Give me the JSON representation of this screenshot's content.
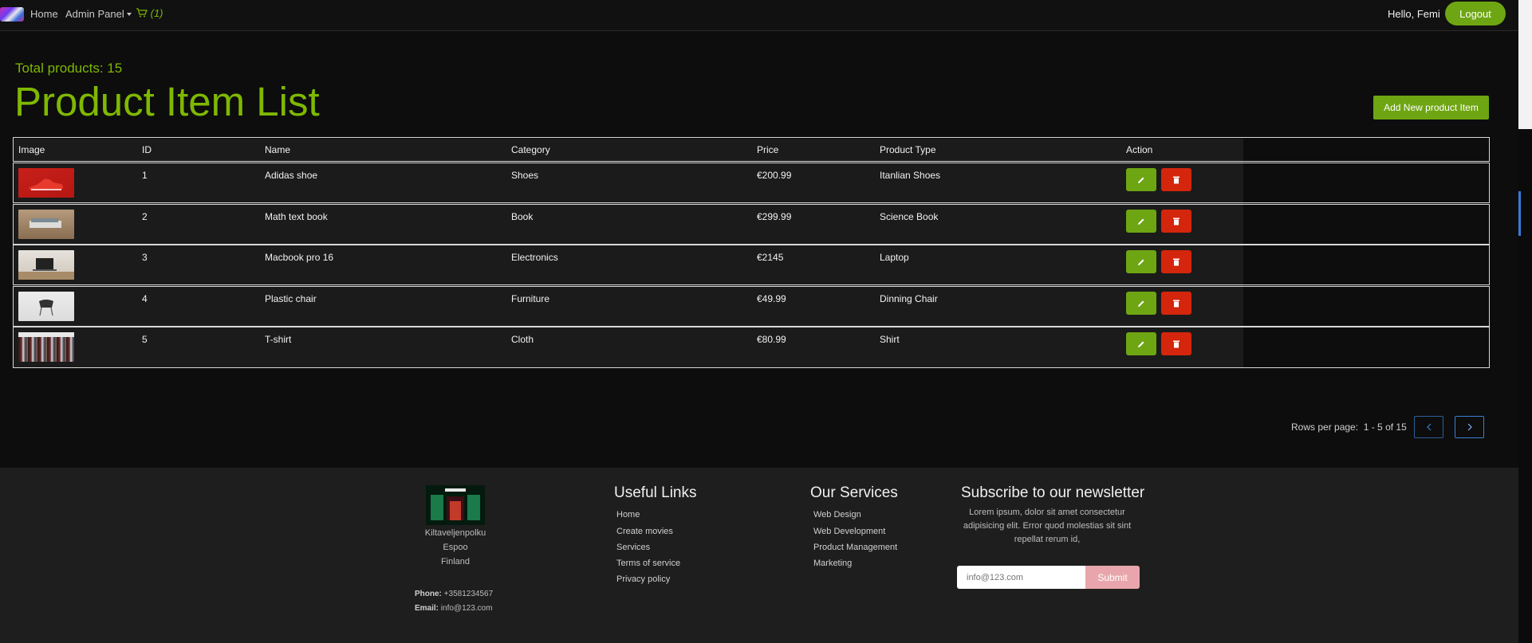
{
  "nav": {
    "home": "Home",
    "admin_panel": "Admin Panel",
    "cart_count": "(1)",
    "greeting": "Hello, Femi",
    "logout": "Logout"
  },
  "header": {
    "total": "Total products: 15",
    "title": "Product Item List",
    "add_button": "Add New product Item"
  },
  "table": {
    "columns": [
      "Image",
      "ID",
      "Name",
      "Category",
      "Price",
      "Product Type",
      "Action"
    ],
    "rows": [
      {
        "id": "1",
        "name": "Adidas shoe",
        "category": "Shoes",
        "price": "€200.99",
        "type": "Itanlian Shoes"
      },
      {
        "id": "2",
        "name": "Math text book",
        "category": "Book",
        "price": "€299.99",
        "type": "Science Book"
      },
      {
        "id": "3",
        "name": "Macbook pro 16",
        "category": "Electronics",
        "price": "€2145",
        "type": "Laptop"
      },
      {
        "id": "4",
        "name": "Plastic chair",
        "category": "Furniture",
        "price": "€49.99",
        "type": "Dinning Chair"
      },
      {
        "id": "5",
        "name": "T-shirt",
        "category": "Cloth",
        "price": "€80.99",
        "type": "Shirt"
      }
    ]
  },
  "pagination": {
    "label": "Rows per page:",
    "range": "1 - 5 of 15"
  },
  "footer": {
    "address": [
      "Kiltaveljenpolku",
      "Espoo",
      "Finland"
    ],
    "phone_label": "Phone:",
    "phone": "+3581234567",
    "email_label": "Email:",
    "email": "info@123.com",
    "useful_links_title": "Useful Links",
    "useful_links": [
      "Home",
      "Create movies",
      "Services",
      "Terms of service",
      "Privacy policy"
    ],
    "services_title": "Our Services",
    "services": [
      "Web Design",
      "Web Development",
      "Product Management",
      "Marketing"
    ],
    "newsletter_title": "Subscribe to our newsletter",
    "newsletter_text": "Lorem ipsum, dolor sit amet consectetur adipisicing elit. Error quod molestias sit sint repellat rerum id,",
    "newsletter_placeholder": "info@123.com",
    "submit": "Submit"
  },
  "colors": {
    "accent": "#7fb800",
    "edit": "#6ea513",
    "delete": "#d4260d",
    "submit": "#e8a6ac"
  }
}
